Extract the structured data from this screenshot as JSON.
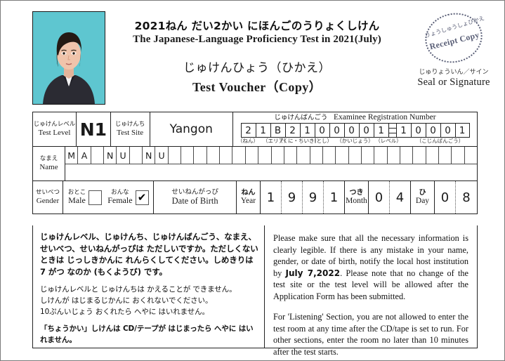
{
  "header": {
    "title_jp": "2021ねん だい2かい にほんごのうりょくしけん",
    "title_en": "The Japanese-Language Proficiency Test in 2021(July)",
    "subtitle_jp": "じゅけんひょう（ひかえ）",
    "subtitle_en": "Test Voucher（Copy）",
    "stamp_jp": "りょうしゅうしょひかえ",
    "stamp_en": "Receipt  Copy",
    "seal_jp": "じゅりょういん／サイン",
    "seal_en": "Seal or Signature",
    "photo_alt": "applicant-photo"
  },
  "form": {
    "test_level": {
      "jp": "じゅけんレベル",
      "en": "Test Level",
      "value": "N1"
    },
    "test_site": {
      "jp": "じゅけんち",
      "en": "Test Site",
      "value": "Yangon"
    },
    "registration": {
      "title_jp": "じゅけんばんごう",
      "title_en": "Examinee Registration Number",
      "digits": [
        "2",
        "1",
        "B",
        "2",
        "1",
        "0",
        "0",
        "0",
        "0",
        "1",
        "",
        "1",
        "0",
        "0",
        "0",
        "1"
      ],
      "separator_index": 10,
      "groups": [
        {
          "label": "（ねん）",
          "span": 2
        },
        {
          "label": "（エリア）",
          "span": 1
        },
        {
          "label": "（くに・ちいき）",
          "span": 2
        },
        {
          "label": "（とし）",
          "span": 2
        },
        {
          "label": "（かいじょう）",
          "span": 2
        },
        {
          "label": "（レベル）",
          "span": 2
        },
        {
          "label": "（こじんばんごう）",
          "span": 5
        }
      ]
    },
    "name": {
      "jp": "なまえ",
      "en": "Name",
      "cells": [
        "M",
        "A",
        "",
        "N",
        "U",
        "",
        "N",
        "U",
        "",
        "",
        "",
        "",
        "",
        "",
        "",
        "",
        "",
        "",
        "",
        "",
        "",
        "",
        "",
        "",
        "",
        "",
        "",
        "",
        "",
        "",
        "",
        ""
      ]
    },
    "gender": {
      "jp": "せいべつ",
      "en": "Gender",
      "male": {
        "jp": "おとこ",
        "en": "Male",
        "checked": false,
        "mark": ""
      },
      "female": {
        "jp": "おんな",
        "en": "Female",
        "checked": true,
        "mark": "✔"
      }
    },
    "date_of_birth": {
      "jp": "せいねんがっぴ",
      "en": "Date of Birth",
      "year": {
        "jp": "ねん",
        "en": "Year",
        "digits": [
          "1",
          "9",
          "9",
          "1"
        ]
      },
      "month": {
        "jp": "つき",
        "en": "Month",
        "digits": [
          "0",
          "4"
        ]
      },
      "day": {
        "jp": "ひ",
        "en": "Day",
        "digits": [
          "0",
          "8"
        ]
      }
    }
  },
  "notes": {
    "jp_bold": "じゅけんレベル、じゅけんち、じゅけんばんごう、なまえ、せいべつ、せいねんがっぴは ただしいですか。ただしくない ときは じっしきかんに れんらくしてください。しめきりは 7 がつ なのか (もくようび) です。",
    "jp_p2_line1": "じゅけんレベルと じゅけんちは かえることが できません。",
    "jp_p2_line2": "しけんが はじまるじかんに おくれないでください。",
    "jp_p2_line3": "10ぷんいじょう おくれたら へやに はいれません。",
    "jp_p3": "「ちょうかい」しけんは CD/テープが はじまったら へやに はいれません。",
    "en_p1_a": "Please make sure that all the necessary information is clearly legible. If there is any mistake in your name, gender, or date of birth, notify the local host institution by ",
    "en_deadline": "July 7,2022",
    "en_p1_b": ". Please note that no change of the test site or the test level will be allowed after the Application Form has been submitted.",
    "en_p2": "For 'Listening' Section, you are not allowed to enter the test room at any time after the CD/tape is set to run. For other sections, enter the room no later than 10 minutes after the test starts."
  },
  "colors": {
    "photo_background": "#5ec6d0",
    "border": "#222222",
    "stamp": "#5a5f77"
  }
}
